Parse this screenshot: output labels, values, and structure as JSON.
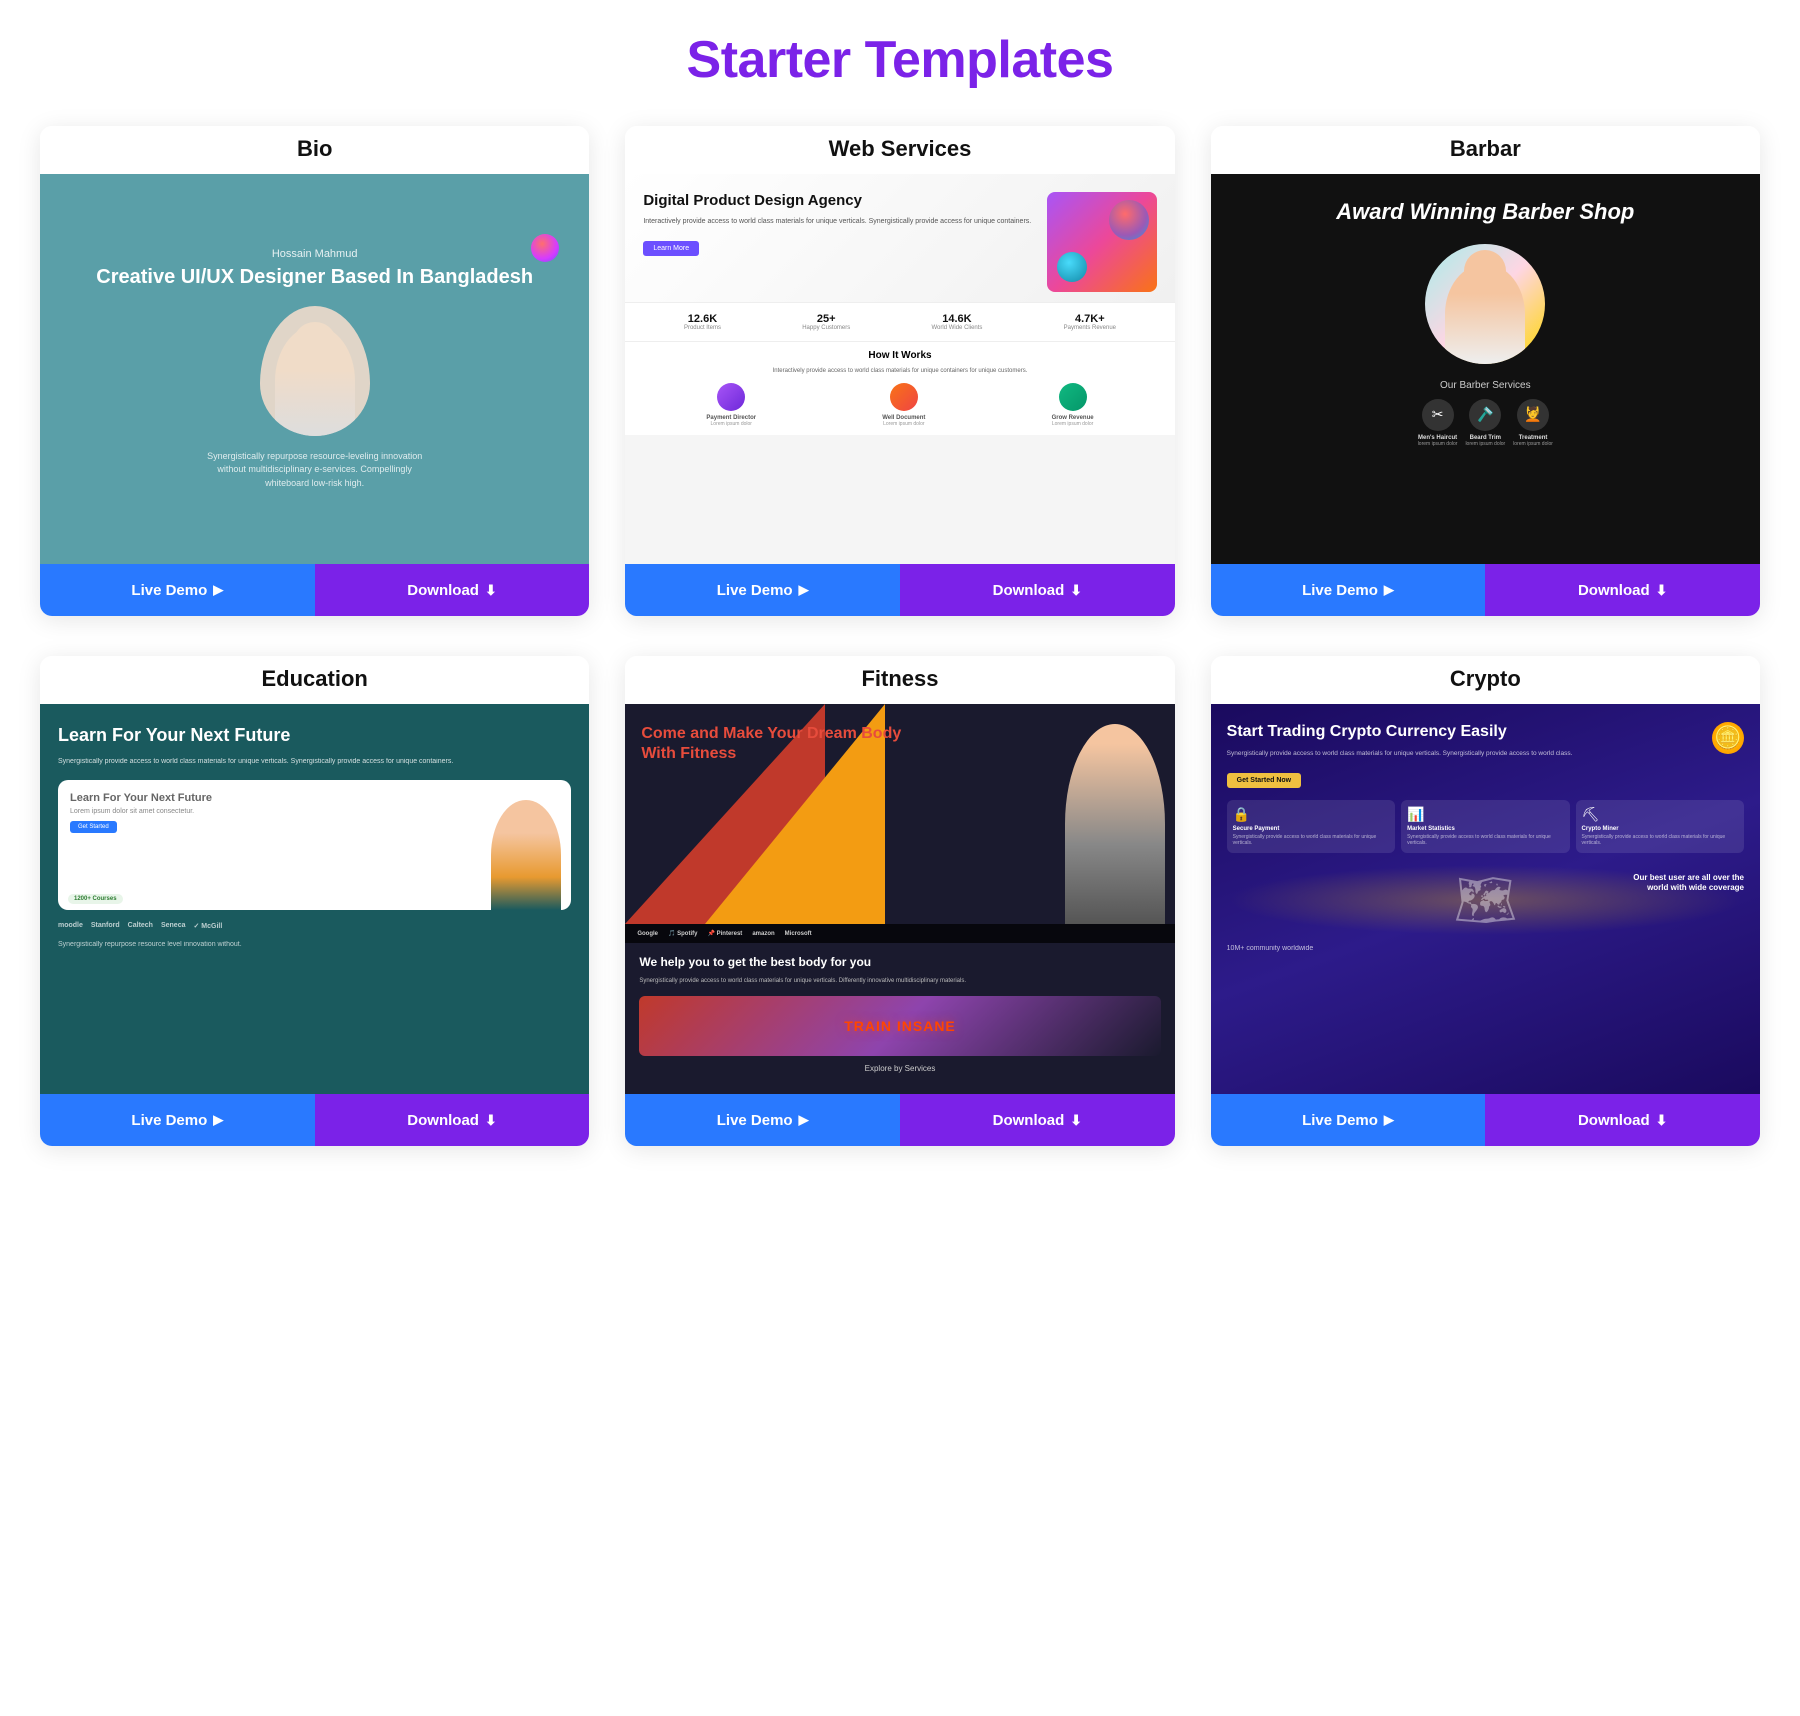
{
  "page": {
    "title": "Starter Templates"
  },
  "cards": [
    {
      "id": "bio",
      "title": "Bio",
      "isNew": true,
      "liveDemoLabel": "Live Demo",
      "downloadLabel": "Download",
      "preview": {
        "name": "Hossain Mahmud",
        "headline": "Creative UI/UX Designer Based In Bangladesh",
        "desc": "Synergistically repurpose resource-leveling innovation without multidisciplinary e-services. Compellingly whiteboard low-risk high."
      }
    },
    {
      "id": "web-services",
      "title": "Web Services",
      "isNew": false,
      "liveDemoLabel": "Live Demo",
      "downloadLabel": "Download",
      "preview": {
        "headline": "Digital Product Design Agency",
        "stat1val": "12.6K",
        "stat1lbl": "Product Items",
        "stat2val": "25+",
        "stat2lbl": "Happy Customers",
        "stat3val": "14.6K",
        "stat3lbl": "World Wide Clients",
        "stat4val": "4.7K+",
        "stat4lbl": "Payments Revenue",
        "howTitle": "How It Works",
        "icon1": "Payment Director",
        "icon2": "Well Document",
        "icon3": "Grow Revenue"
      }
    },
    {
      "id": "barbar",
      "title": "Barbar",
      "isNew": false,
      "liveDemoLabel": "Live Demo",
      "downloadLabel": "Download",
      "preview": {
        "headline": "Award Winning Barber Shop",
        "servicesTitle": "Our Barber Services",
        "service1": "Men's Haircut",
        "service2": "Beard Trim",
        "service3": "Treatment"
      }
    },
    {
      "id": "education",
      "title": "Education",
      "isNew": true,
      "liveDemoLabel": "Live Demo",
      "downloadLabel": "Download",
      "preview": {
        "headline": "Learn For Your Next Future",
        "brands": [
          "moodle",
          "Stanford",
          "Caltech",
          "Seneca",
          "McGill"
        ],
        "desc2": "Synergistically repurpose resource level innovation without.",
        "courses": "1200+ Courses"
      }
    },
    {
      "id": "fitness",
      "title": "Fitness",
      "isNew": false,
      "liveDemoLabel": "Live Demo",
      "downloadLabel": "Download",
      "preview": {
        "headline": "Come and Make Your Dream Body",
        "headlineSub": "With Fitness",
        "brands": [
          "Google",
          "Spotify",
          "Pinterest",
          "amazon",
          "Microsoft"
        ],
        "sectionTitle": "We help you to get the best body for you",
        "bottomText": "TRAIN INSANE",
        "explore": "Explore by Services"
      }
    },
    {
      "id": "crypto",
      "title": "Crypto",
      "isNew": true,
      "liveDemoLabel": "Live Demo",
      "downloadLabel": "Download",
      "preview": {
        "headline": "Start Trading Crypto Currency Easily",
        "desc": "Synergistically provide access to world class materials for unique verticals. Synergistically provide access to world class.",
        "btnLabel": "Get Started Now",
        "card1title": "Secure Payment",
        "card2title": "Market Statistics",
        "card3title": "Crypto Miner",
        "worldText": "Our best user are all over the world with wide coverage",
        "users": "10M+",
        "usersLabel": "community worldwide"
      }
    }
  ]
}
